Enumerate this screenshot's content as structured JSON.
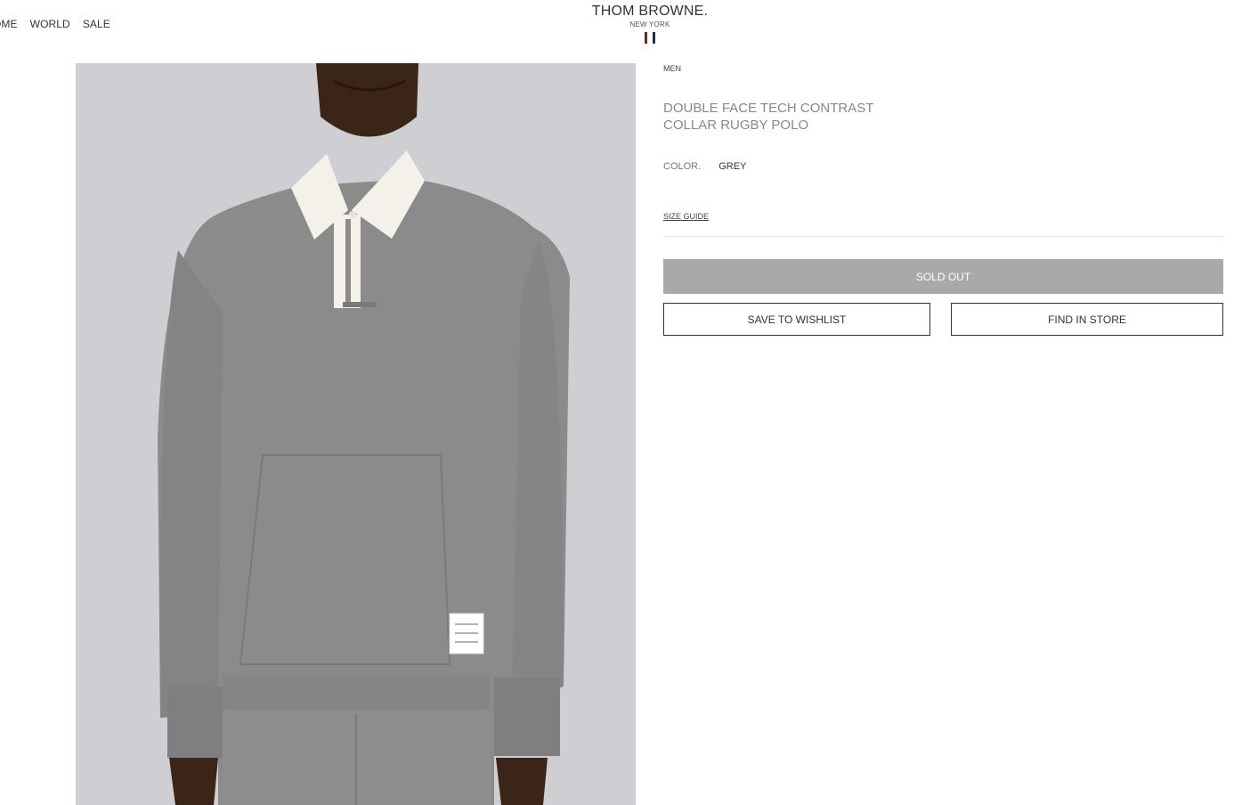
{
  "nav": {
    "items": [
      "OME",
      "WORLD",
      "SALE"
    ]
  },
  "brand": {
    "name": "THOM BROWNE.",
    "sub": "NEW YORK",
    "flag_colors": [
      "#7a1f2b",
      "#ffffff",
      "#1d2a57"
    ]
  },
  "product": {
    "category": "MEN",
    "title": "DOUBLE FACE TECH CONTRAST COLLAR RUGBY POLO",
    "color_label": "COLOR.",
    "color_value": "GREY",
    "size_guide": "SIZE GUIDE",
    "sold_out": "SOLD OUT",
    "wishlist": "SAVE TO WISHLIST",
    "find_store": "FIND IN STORE",
    "image_icon": "product-photo"
  },
  "colors": {
    "image_bg": "#cfced3",
    "sold_out_bg": "#a8a9ab",
    "garment": "#8b8b8b",
    "collar": "#f4f1ea",
    "skin": "#3b2418"
  }
}
